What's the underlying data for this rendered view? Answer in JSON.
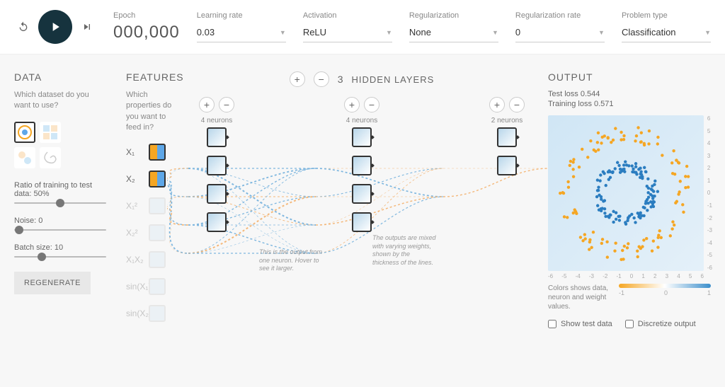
{
  "header": {
    "epoch_label": "Epoch",
    "epoch_value": "000,000",
    "learning_rate": {
      "label": "Learning rate",
      "value": "0.03"
    },
    "activation": {
      "label": "Activation",
      "value": "ReLU"
    },
    "regularization": {
      "label": "Regularization",
      "value": "None"
    },
    "reg_rate": {
      "label": "Regularization rate",
      "value": "0"
    },
    "problem_type": {
      "label": "Problem type",
      "value": "Classification"
    }
  },
  "data_panel": {
    "title": "DATA",
    "subtitle": "Which dataset do you want to use?",
    "ratio": {
      "label": "Ratio of training to test data:  50%",
      "value": 50
    },
    "noise": {
      "label": "Noise:  0",
      "value": 0
    },
    "batch": {
      "label": "Batch size:  10",
      "value": 10
    },
    "regenerate": "REGENERATE"
  },
  "features_panel": {
    "title": "FEATURES",
    "subtitle": "Which properties do you want to feed in?",
    "items": [
      "X₁",
      "X₂",
      "X₁²",
      "X₂²",
      "X₁X₂",
      "sin(X₁)",
      "sin(X₂)"
    ]
  },
  "network": {
    "hidden_count": "3",
    "hidden_label": "HIDDEN LAYERS",
    "layers": [
      {
        "neurons": 4,
        "label": "4 neurons"
      },
      {
        "neurons": 4,
        "label": "4 neurons"
      },
      {
        "neurons": 2,
        "label": "2 neurons"
      }
    ],
    "hint1": "This is the output from one neuron. Hover to see it larger.",
    "hint2": "The outputs are mixed with varying weights, shown by the thickness of the lines."
  },
  "output": {
    "title": "OUTPUT",
    "test_loss": "Test loss 0.544",
    "training_loss": "Training loss 0.571",
    "legend_text": "Colors shows data, neuron and weight values.",
    "grad_min": "-1",
    "grad_mid": "0",
    "grad_max": "1",
    "check_test": "Show test data",
    "check_disc": "Discretize output",
    "axis_ticks": [
      "-6",
      "-5",
      "-4",
      "-3",
      "-2",
      "-1",
      "0",
      "1",
      "2",
      "3",
      "4",
      "5",
      "6"
    ]
  }
}
